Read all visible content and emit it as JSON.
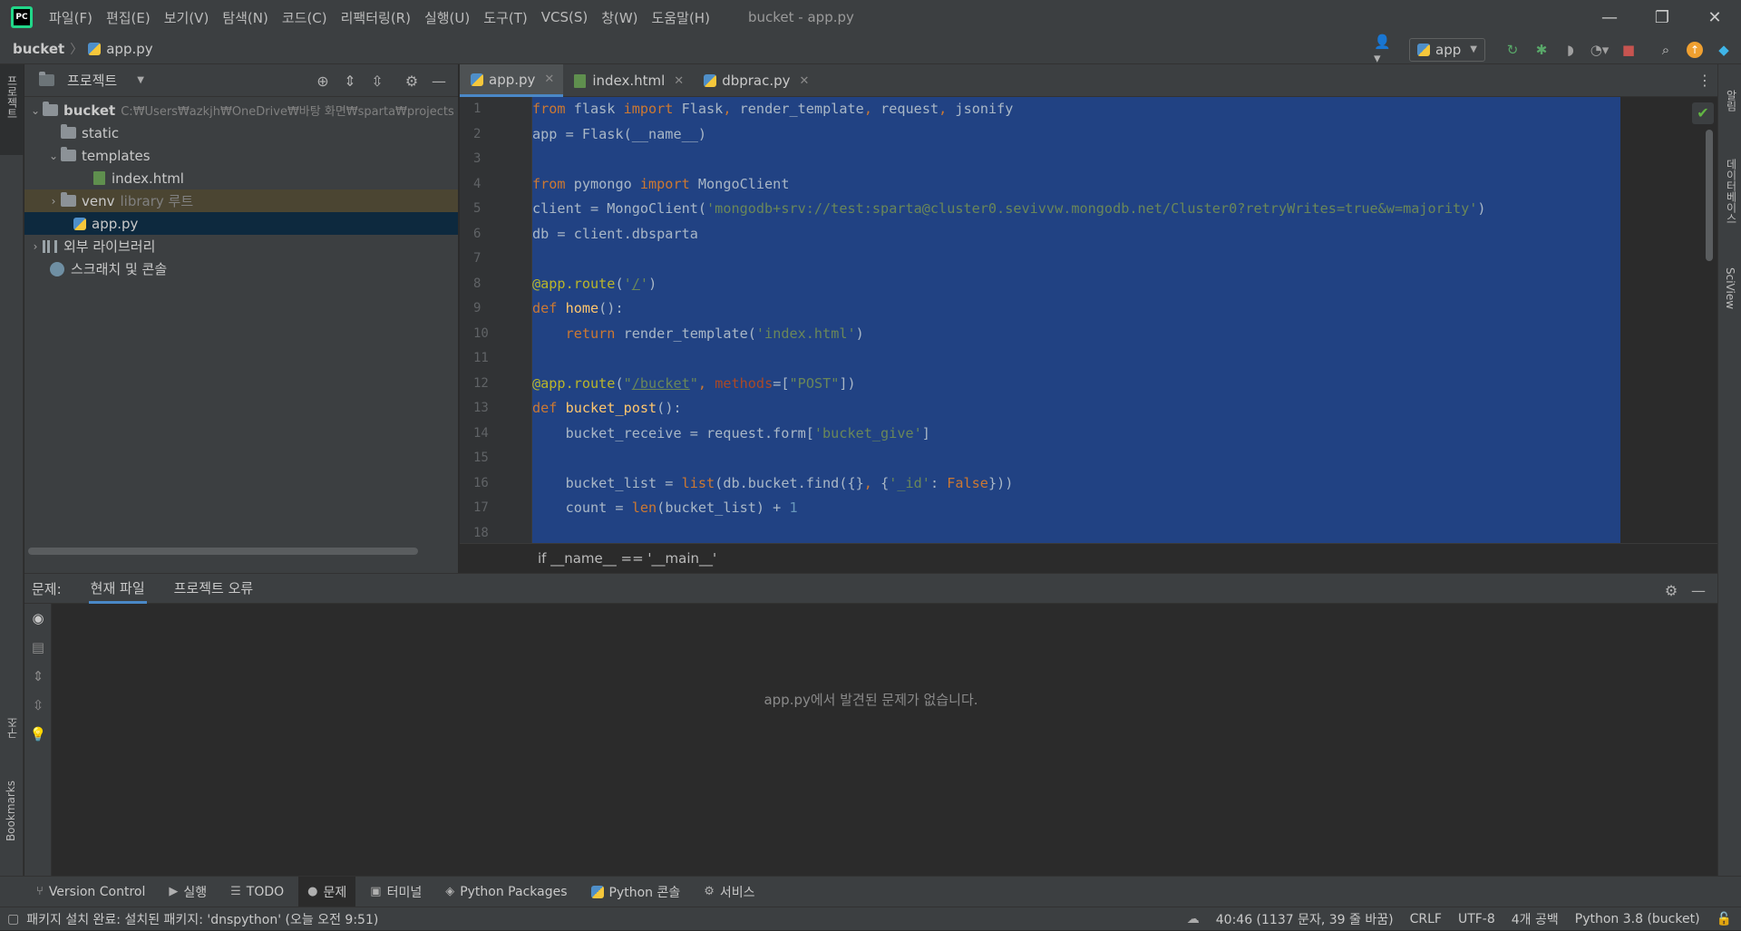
{
  "menubar": {
    "items": [
      "파일(F)",
      "편집(E)",
      "보기(V)",
      "탐색(N)",
      "코드(C)",
      "리팩터링(R)",
      "실행(U)",
      "도구(T)",
      "VCS(S)",
      "창(W)",
      "도움말(H)"
    ],
    "window_title": "bucket - app.py",
    "controls": {
      "minimize": "—",
      "restore": "❐",
      "close": "✕"
    }
  },
  "navbar": {
    "root": "bucket",
    "file": "app.py",
    "run_config": "app"
  },
  "left_stripe": {
    "project": "프로젝트",
    "structure": "구조",
    "bookmarks": "Bookmarks"
  },
  "right_stripe": {
    "notifications": "알림",
    "database": "데이터베이스",
    "sciview": "SciView"
  },
  "project_panel": {
    "title": "프로젝트",
    "tree": {
      "root_name": "bucket",
      "root_path": "C:₩Users₩azkjh₩OneDrive₩바탕 화면₩sparta₩projects",
      "static": "static",
      "templates": "templates",
      "index_html": "index.html",
      "venv": "venv",
      "venv_hint": "library 루트",
      "app_py": "app.py",
      "external_libs": "외부 라이브러리",
      "scratches": "스크래치 및 콘솔"
    }
  },
  "editor": {
    "tabs": [
      {
        "label": "app.py",
        "active": true
      },
      {
        "label": "index.html",
        "active": false
      },
      {
        "label": "dbprac.py",
        "active": false
      }
    ],
    "line_numbers": [
      "1",
      "2",
      "3",
      "4",
      "5",
      "6",
      "7",
      "8",
      "9",
      "10",
      "11",
      "12",
      "13",
      "14",
      "15",
      "16",
      "17",
      "18"
    ],
    "code": {
      "l1": {
        "kw1": "from",
        "t1": " flask ",
        "kw2": "import",
        "t2": " Flask",
        "c1": ",",
        "t3": " render_template",
        "c2": ",",
        "t4": " request",
        "c3": ",",
        "t5": " jsonify"
      },
      "l2": {
        "t1": "app = Flask(__name__)"
      },
      "l4": {
        "kw1": "from",
        "t1": " pymongo ",
        "kw2": "import",
        "t2": " MongoClient"
      },
      "l5": {
        "t1": "client = MongoClient(",
        "s1": "'mongodb+srv://test:sparta@cluster0.sevivvw.mongodb.net/Cluster0?retryWrites=true&w=majority'",
        "t2": ")"
      },
      "l6": {
        "t1": "db = client.dbsparta"
      },
      "l8": {
        "d1": "@app.route",
        "t1": "(",
        "s1": "'",
        "s2": "/",
        "s3": "'",
        "t2": ")"
      },
      "l9": {
        "kw1": "def",
        "f1": " home",
        "t1": "():"
      },
      "l10": {
        "ind": "    ",
        "kw1": "return",
        "t1": " render_template(",
        "s1": "'index.html'",
        "t2": ")"
      },
      "l12": {
        "d1": "@app.route",
        "t1": "(",
        "s1": "\"",
        "s2": "/bucket",
        "s3": "\"",
        "c1": ", ",
        "k1": "methods",
        "t2": "=[",
        "s4": "\"POST\"",
        "t3": "])"
      },
      "l13": {
        "kw1": "def",
        "f1": " bucket_post",
        "t1": "():"
      },
      "l14": {
        "t1": "    bucket_receive = request.form[",
        "s1": "'bucket_give'",
        "t2": "]"
      },
      "l16": {
        "t1": "    bucket_list = ",
        "b1": "list",
        "t2": "(db.bucket.find({}",
        "c1": ", ",
        "t3": "{",
        "s1": "'_id'",
        "t4": ": ",
        "kw1": "False",
        "t5": "}))"
      },
      "l17": {
        "t1": "    count = ",
        "b1": "len",
        "t2": "(bucket_list) + ",
        "n1": "1"
      }
    },
    "breadcrumb": "if __name__ == '__main__'"
  },
  "problems": {
    "label": "문제:",
    "tabs": [
      "현재 파일",
      "프로젝트 오류"
    ],
    "empty_message": "app.py에서 발견된 문제가 없습니다."
  },
  "tool_windows": [
    "Version Control",
    "실행",
    "TODO",
    "문제",
    "터미널",
    "Python Packages",
    "Python 콘솔",
    "서비스"
  ],
  "statusbar": {
    "message": "패키지 설치 완료: 설치된 패키지: 'dnspython' (오늘 오전 9:51)",
    "position": "40:46 (1137 문자, 39 줄 바꿈)",
    "line_sep": "CRLF",
    "encoding": "UTF-8",
    "indent": "4개 공백",
    "interpreter": "Python 3.8 (bucket)"
  },
  "colors": {
    "selection": "#214283",
    "accent": "#4a88c7",
    "keyword": "#cc7832",
    "string": "#6a8759",
    "decorator": "#bbb529"
  }
}
